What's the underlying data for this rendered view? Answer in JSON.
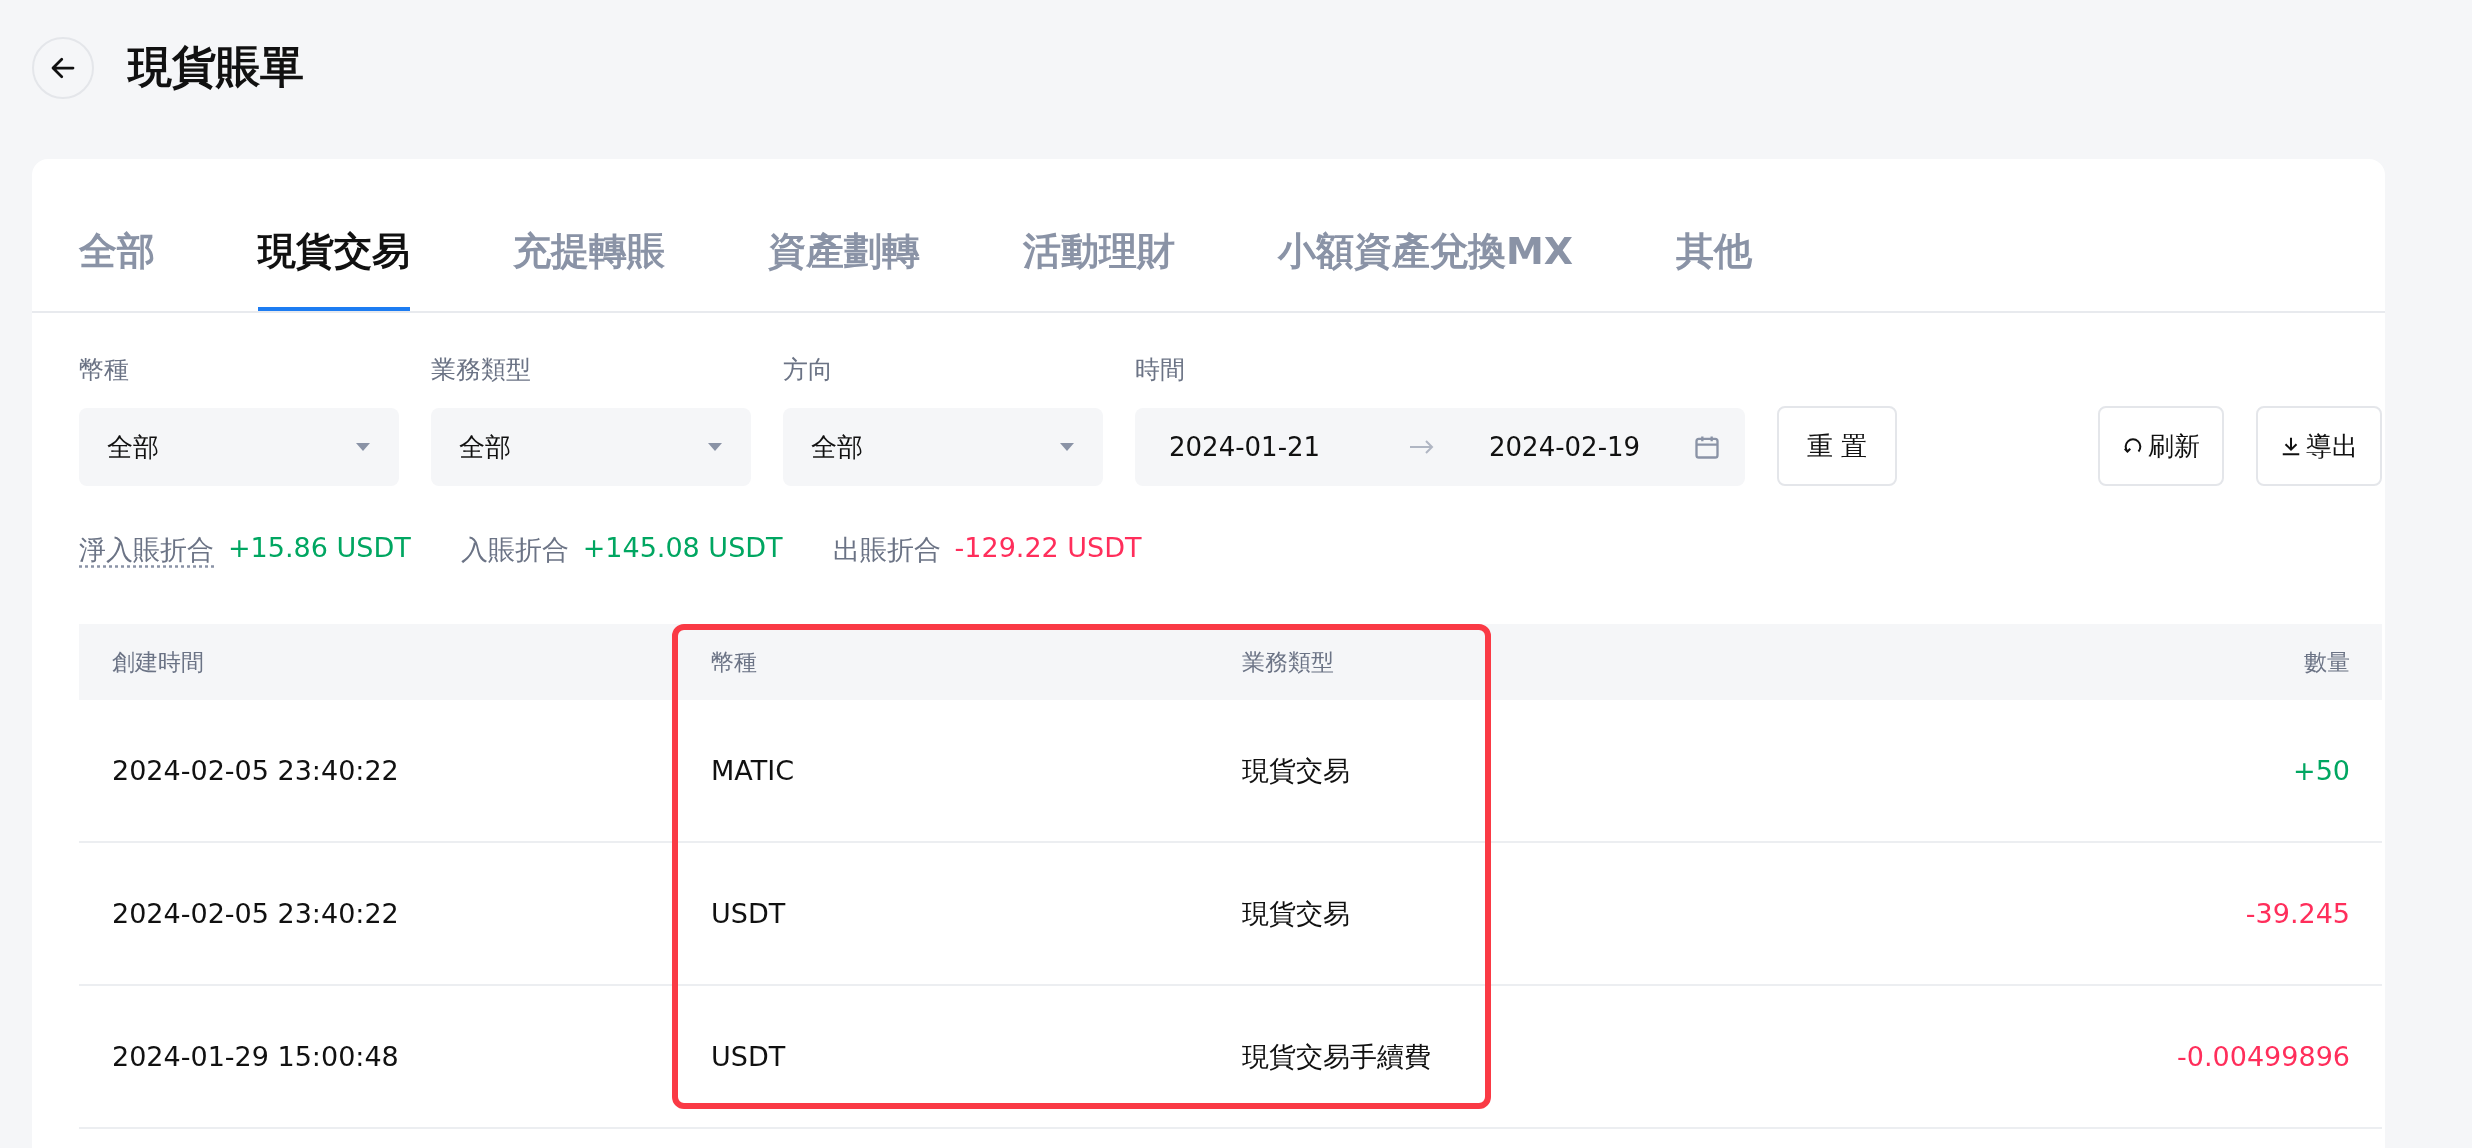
{
  "page": {
    "title": "現貨賬單"
  },
  "tabs": [
    {
      "label": "全部",
      "selected": false
    },
    {
      "label": "現貨交易",
      "selected": true
    },
    {
      "label": "充提轉賬",
      "selected": false
    },
    {
      "label": "資產劃轉",
      "selected": false
    },
    {
      "label": "活動理財",
      "selected": false
    },
    {
      "label": "小額資產兌換MX",
      "selected": false
    },
    {
      "label": "其他",
      "selected": false
    }
  ],
  "filters": [
    {
      "label": "幣種",
      "value": "全部"
    },
    {
      "label": "業務類型",
      "value": "全部"
    },
    {
      "label": "方向",
      "value": "全部"
    }
  ],
  "time_filter": {
    "label": "時間",
    "start": "2024-01-21",
    "end": "2024-02-19"
  },
  "buttons": {
    "reset": "重 置",
    "refresh": "刷新",
    "export": "導出"
  },
  "summary": [
    {
      "label": "淨入賬折合",
      "value": "+15.86 USDT",
      "color": "#00a661",
      "dotted": true
    },
    {
      "label": "入賬折合",
      "value": "+145.08 USDT",
      "color": "#00a661",
      "dotted": false
    },
    {
      "label": "出賬折合",
      "value": "-129.22 USDT",
      "color": "#ff2e5b",
      "dotted": false
    }
  ],
  "table": {
    "columns": [
      "創建時間",
      "幣種",
      "業務類型",
      "數量"
    ],
    "highlight_box": true,
    "rows": [
      {
        "time": "2024-02-05 23:40:22",
        "coin": "MATIC",
        "type": "現貨交易",
        "amount": "+50",
        "color": "#00a661"
      },
      {
        "time": "2024-02-05 23:40:22",
        "coin": "USDT",
        "type": "現貨交易",
        "amount": "-39.245",
        "color": "#ff2e5b"
      },
      {
        "time": "2024-01-29 15:00:48",
        "coin": "USDT",
        "type": "現貨交易手續費",
        "amount": "-0.00499896",
        "color": "#ff2e5b"
      }
    ]
  }
}
